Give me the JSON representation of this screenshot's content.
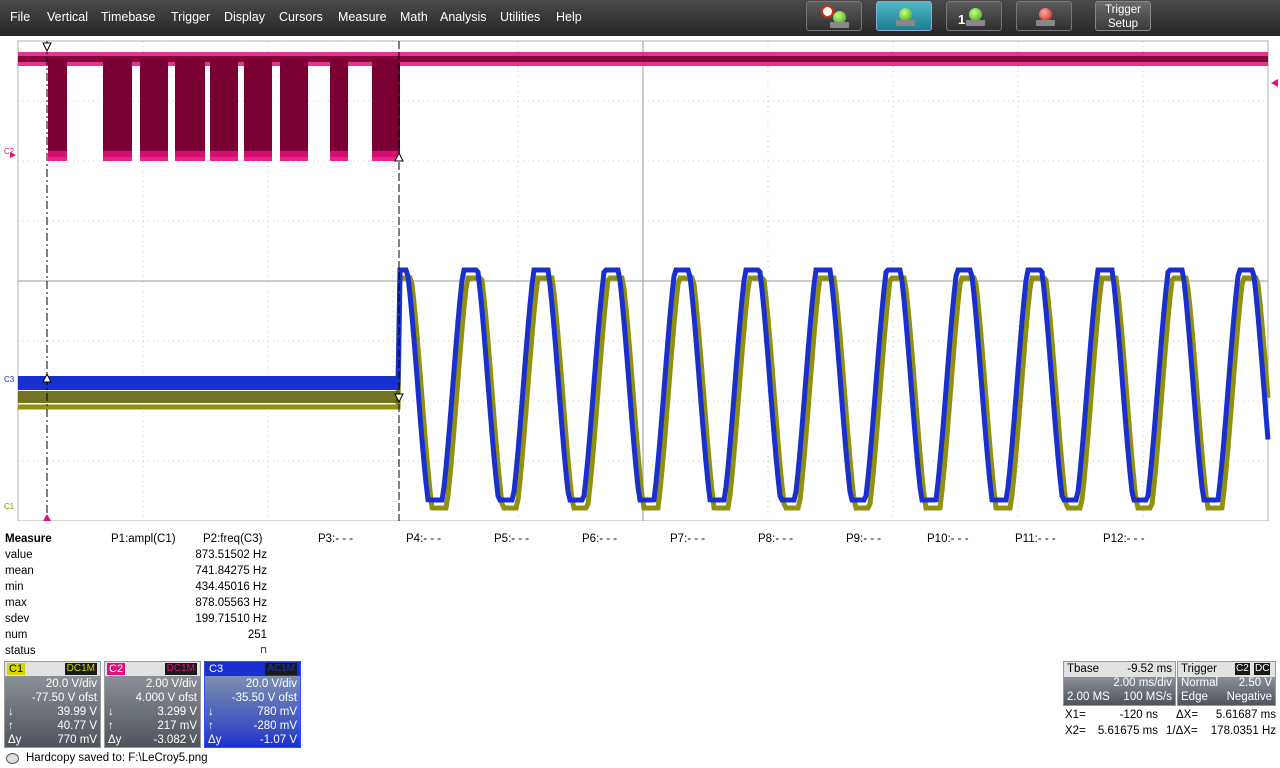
{
  "menu": {
    "items": [
      "File",
      "Vertical",
      "Timebase",
      "Trigger",
      "Display",
      "Cursors",
      "Measure",
      "Math",
      "Analysis",
      "Utilities",
      "Help"
    ],
    "trigger_setup": [
      "Trigger",
      "Setup"
    ],
    "toolbar_icons": [
      "auto-setup-icon",
      "normal-trigger-icon",
      "single-trigger-icon",
      "stop-trigger-icon"
    ],
    "single_digit": "1"
  },
  "screen": {
    "c1_label": "C1",
    "c2_label": "C2",
    "c3_label": "C3",
    "colors": {
      "c1": "#8a8a00",
      "c2": "#e0107a",
      "c3": "#1a2fd0",
      "c1_dark": "#5c5c00",
      "c2_dark": "#7a0033",
      "grid": "#c8c8c8"
    }
  },
  "measure": {
    "title": "Measure",
    "params": [
      "P1:ampl(C1)",
      "P2:freq(C3)",
      "P3:- - -",
      "P4:- - -",
      "P5:- - -",
      "P6:- - -",
      "P7:- - -",
      "P8:- - -",
      "P9:- - -",
      "P10:- - -",
      "P11:- - -",
      "P12:- - -"
    ],
    "rows": [
      {
        "label": "value",
        "v": "873.51502 Hz"
      },
      {
        "label": "mean",
        "v": "741.84275 Hz"
      },
      {
        "label": "min",
        "v": "434.45016 Hz"
      },
      {
        "label": "max",
        "v": "878.05563 Hz"
      },
      {
        "label": "sdev",
        "v": "199.71510 Hz"
      },
      {
        "label": "num",
        "v": "251"
      },
      {
        "label": "status",
        "v": "⊓"
      }
    ]
  },
  "channels": [
    {
      "tag": "C1",
      "coupling": "DC1M",
      "vdiv": "20.0 V/div",
      "ofst": "-77.50 V ofst",
      "down": "39.99 V",
      "up": "40.77 V",
      "dy": "770 mV",
      "color": "#d6d600",
      "tagtext": "#000000"
    },
    {
      "tag": "C2",
      "coupling": "DC1M",
      "vdiv": "2.00 V/div",
      "ofst": "4.000 V ofst",
      "down": "3.299 V",
      "up": "217 mV",
      "dy": "-3.082 V",
      "color": "#e0107a",
      "tagtext": "#ffffff"
    },
    {
      "tag": "C3",
      "coupling": "AC1M",
      "vdiv": "20.0 V/div",
      "ofst": "-35.50 V ofst",
      "down": "780 mV",
      "up": "-280 mV",
      "dy": "-1.07 V",
      "color": "#1a2fd0",
      "tagtext": "#ffffff"
    }
  ],
  "cursor_symbols": {
    "down": "↓",
    "up": "↑",
    "dy": "Δy"
  },
  "tbase": {
    "label": "Tbase",
    "delay": "-9.52 ms",
    "tdiv": "2.00 ms/div",
    "points": "2.00 MS",
    "rate": "100 MS/s"
  },
  "trigger": {
    "label": "Trigger",
    "source": "C2",
    "coupling": "DC",
    "mode": "Normal",
    "level": "2.50 V",
    "type": "Edge",
    "slope": "Negative"
  },
  "cursors": {
    "x1_label": "X1=",
    "x1": "-120 ns",
    "dx_label": "ΔX=",
    "dx": "5.61687 ms",
    "x2_label": "X2=",
    "x2": "5.61675 ms",
    "inv_label": "1/ΔX=",
    "inv": "178.0351 Hz"
  },
  "status": {
    "text": "Hardcopy saved to: F:\\LeCroy5.png"
  }
}
